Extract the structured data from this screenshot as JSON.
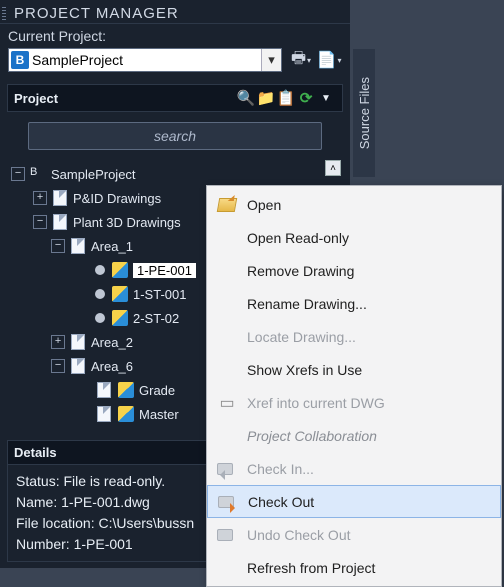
{
  "title": "PROJECT MANAGER",
  "current_project_label": "Current Project:",
  "project_name": "SampleProject",
  "vtab_label": "Source Files",
  "section_project": "Project",
  "section_details": "Details",
  "search_placeholder": "search",
  "tree": {
    "root": "SampleProject",
    "pid": "P&ID Drawings",
    "plant3d": "Plant 3D Drawings",
    "area1": "Area_1",
    "area2": "Area_2",
    "area6": "Area_6",
    "pe001": "1-PE-001",
    "st001": "1-ST-001",
    "st02": "2-ST-02",
    "grade": "Grade",
    "master": "Master"
  },
  "details": {
    "status": "Status: File is read-only.",
    "name": "Name:  1-PE-001.dwg",
    "location": "File location:  C:\\Users\\bussn",
    "number": "Number:  1-PE-001"
  },
  "menu": {
    "open": "Open",
    "open_ro": "Open Read-only",
    "remove": "Remove Drawing",
    "rename": "Rename Drawing...",
    "locate": "Locate Drawing...",
    "xrefs": "Show Xrefs in Use",
    "xref_into": "Xref into current DWG",
    "collab": "Project Collaboration",
    "checkin": "Check In...",
    "checkout": "Check Out",
    "undo": "Undo Check Out",
    "refresh": "Refresh from Project"
  }
}
